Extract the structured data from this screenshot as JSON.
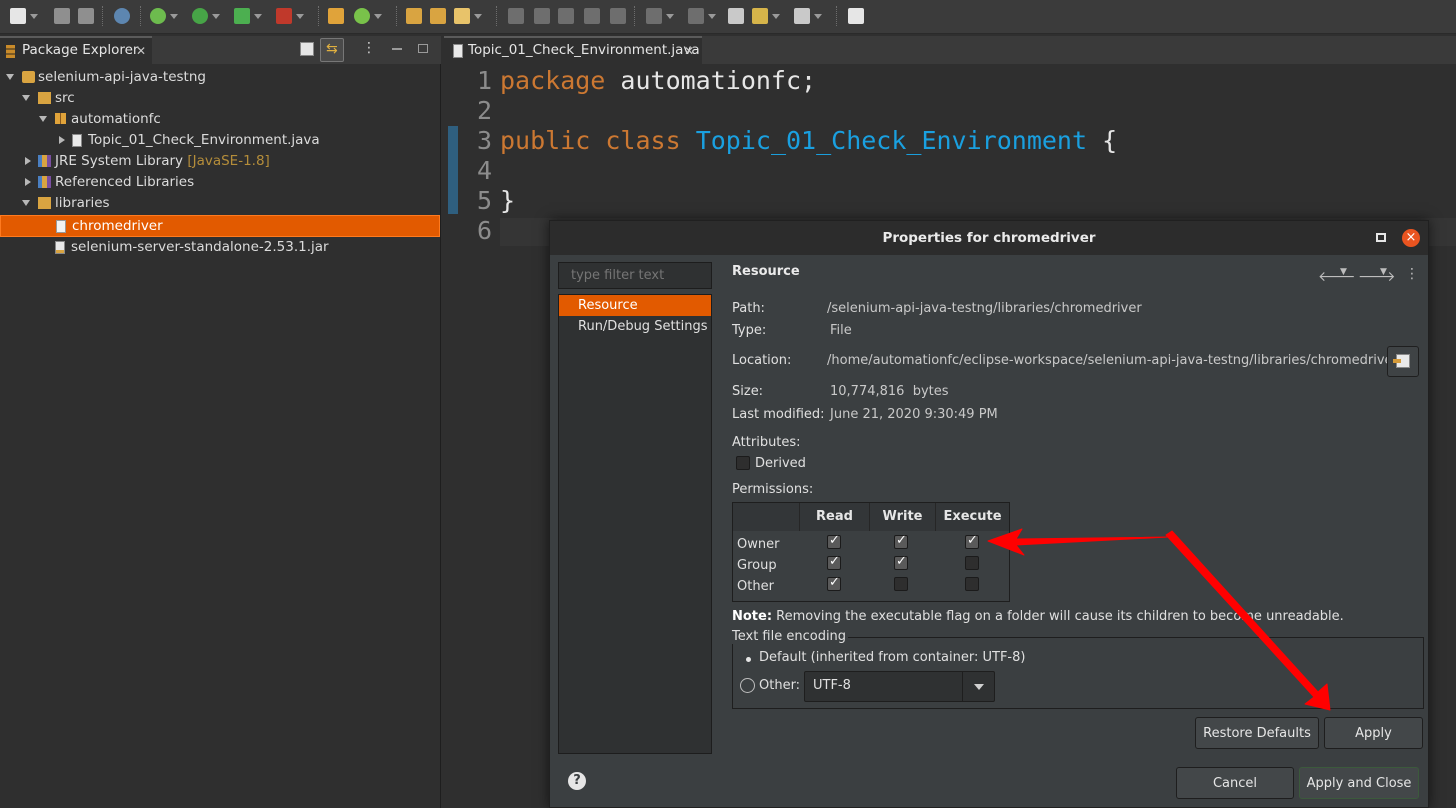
{
  "explorer": {
    "tab_label": "Package Explorer",
    "tree": [
      {
        "label": "selenium-api-java-testng",
        "decor": ""
      },
      {
        "label": "src",
        "decor": ""
      },
      {
        "label": "automationfc",
        "decor": ""
      },
      {
        "label": "Topic_01_Check_Environment.java",
        "decor": ""
      },
      {
        "label": "JRE System Library",
        "decor": "[JavaSE-1.8]"
      },
      {
        "label": "Referenced Libraries",
        "decor": ""
      },
      {
        "label": "libraries",
        "decor": ""
      },
      {
        "label": "chromedriver",
        "decor": ""
      },
      {
        "label": "selenium-server-standalone-2.53.1.jar",
        "decor": ""
      }
    ]
  },
  "editor": {
    "tab_label": "Topic_01_Check_Environment.java",
    "lines": [
      {
        "n": "1"
      },
      {
        "n": "2"
      },
      {
        "n": "3"
      },
      {
        "n": "4"
      },
      {
        "n": "5"
      },
      {
        "n": "6"
      }
    ],
    "code": {
      "l1_kw": "package",
      "l1_rest": " automationfc;",
      "l3_kw": "public class",
      "l3_cls": "Topic_01_Check_Environment",
      "l3_rest": " {",
      "l5": "}"
    }
  },
  "dialog": {
    "title": "Properties for chromedriver",
    "filter_placeholder": "type filter text",
    "nav": [
      "Resource",
      "Run/Debug Settings"
    ],
    "page_title": "Resource",
    "path_label": "Path:",
    "path_value": "/selenium-api-java-testng/libraries/chromedriver",
    "type_label": "Type:",
    "type_value": "File",
    "location_label": "Location:",
    "location_value": "/home/automationfc/eclipse-workspace/selenium-api-java-testng/libraries/chromedriver",
    "size_label": "Size:",
    "size_value": "10,774,816  bytes",
    "modified_label": "Last modified:",
    "modified_value": "June 21, 2020 9:30:49 PM",
    "attributes_label": "Attributes:",
    "derived_label": "Derived",
    "derived_checked": false,
    "permissions_label": "Permissions:",
    "perm_columns": [
      "Read",
      "Write",
      "Execute"
    ],
    "perm_rows": [
      {
        "name": "Owner",
        "read": true,
        "write": true,
        "execute": true
      },
      {
        "name": "Group",
        "read": true,
        "write": true,
        "execute": false
      },
      {
        "name": "Other",
        "read": true,
        "write": false,
        "execute": false
      }
    ],
    "note_bold": "Note:",
    "note_text": " Removing the executable flag on a folder will cause its children to become unreadable.",
    "encoding_label": "Text file encoding",
    "enc_default_label": "Default (inherited from container: UTF-8)",
    "enc_other_label": "Other:",
    "enc_other_value": "UTF-8",
    "enc_selected": "default",
    "buttons": {
      "restore": "Restore Defaults",
      "apply": "Apply",
      "cancel": "Cancel",
      "apply_close": "Apply and Close"
    },
    "help_glyph": "?",
    "close_glyph": "×"
  },
  "colors": {
    "selection": "#e25a00",
    "keyword": "#cc7832",
    "class_name": "#1aa0e0",
    "annotation_arrow": "#ff0000"
  }
}
